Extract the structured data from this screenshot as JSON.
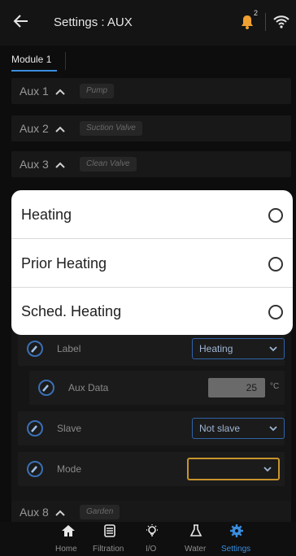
{
  "header": {
    "title": "Settings : AUX",
    "notification_count": "2"
  },
  "module_tab": "Module 1",
  "aux_rows": [
    {
      "name": "Aux 1",
      "label": "Pump"
    },
    {
      "name": "Aux 2",
      "label": "Suction Valve"
    },
    {
      "name": "Aux 3",
      "label": "Clean Valve"
    },
    {
      "name": "Aux 8",
      "label": "Garden"
    }
  ],
  "panel": {
    "label": {
      "title": "Label",
      "value": "Heating"
    },
    "aux_data": {
      "title": "Aux Data",
      "value": "25",
      "unit": "°C"
    },
    "slave": {
      "title": "Slave",
      "value": "Not slave"
    },
    "mode": {
      "title": "Mode",
      "value": ""
    }
  },
  "dropdown_options": [
    "Heating",
    "Prior Heating",
    "Sched. Heating"
  ],
  "nav": [
    {
      "label": "Home",
      "icon": "home-icon"
    },
    {
      "label": "Filtration",
      "icon": "filtration-icon"
    },
    {
      "label": "I/O",
      "icon": "lightbulb-icon"
    },
    {
      "label": "Water",
      "icon": "flask-icon"
    },
    {
      "label": "Settings",
      "icon": "gear-icon"
    }
  ],
  "colors": {
    "accent": "#3a8dde",
    "bell": "#f0a030",
    "mode_border": "#c8942c"
  }
}
